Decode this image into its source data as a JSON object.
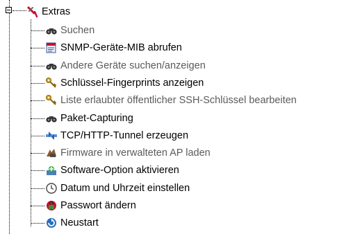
{
  "tree": {
    "root": {
      "label": "Extras",
      "icon": "tools-icon",
      "expanded": true
    },
    "items": [
      {
        "label": "Suchen",
        "icon": "binoculars-icon",
        "state": "disabled"
      },
      {
        "label": "SNMP-Geräte-MIB abrufen",
        "icon": "mib-document-icon",
        "state": "enabled"
      },
      {
        "label": "Andere Geräte suchen/anzeigen",
        "icon": "binoculars-icon",
        "state": "disabled"
      },
      {
        "label": "Schlüssel-Fingerprints anzeigen",
        "icon": "key-icon",
        "state": "enabled"
      },
      {
        "label": "Liste erlaubter öffentlicher SSH-Schlüssel bearbeiten",
        "icon": "key-icon",
        "state": "disabled"
      },
      {
        "label": "Paket-Capturing",
        "icon": "binoculars-icon",
        "state": "enabled"
      },
      {
        "label": "TCP/HTTP-Tunnel erzeugen",
        "icon": "network-tunnel-icon",
        "state": "enabled"
      },
      {
        "label": "Firmware in verwalteten AP laden",
        "icon": "firmware-icon",
        "state": "disabled"
      },
      {
        "label": "Software-Option aktivieren",
        "icon": "software-option-icon",
        "state": "enabled"
      },
      {
        "label": "Datum und Uhrzeit einstellen",
        "icon": "clock-icon",
        "state": "enabled"
      },
      {
        "label": "Passwort ändern",
        "icon": "password-icon",
        "state": "enabled"
      },
      {
        "label": "Neustart",
        "icon": "restart-icon",
        "state": "enabled"
      }
    ]
  }
}
